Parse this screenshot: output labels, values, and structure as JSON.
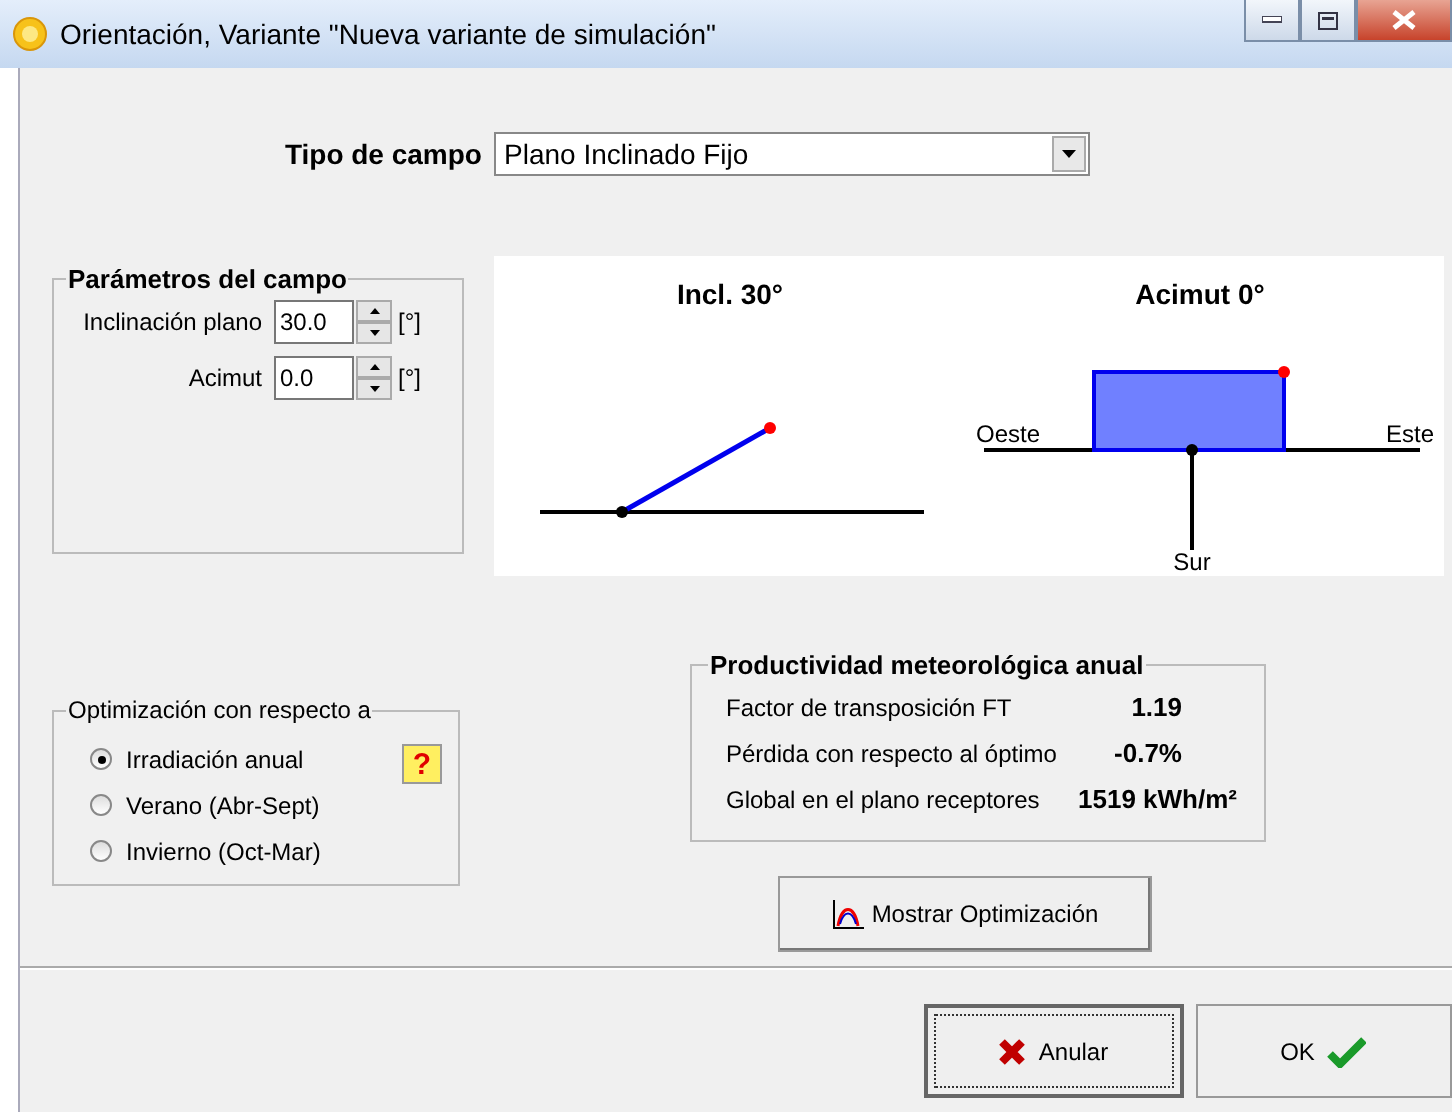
{
  "window": {
    "title": "Orientación, Variante \"Nueva variante de simulación\""
  },
  "field_type": {
    "label": "Tipo de campo",
    "value": "Plano Inclinado Fijo"
  },
  "field_parameters": {
    "title": "Parámetros del campo",
    "fields": [
      {
        "label": "Inclinación plano",
        "value": "30.0",
        "unit": "[°]"
      },
      {
        "label": "Acimut",
        "value": "0.0",
        "unit": "[°]"
      }
    ]
  },
  "diagram": {
    "tilt_title": "Incl. 30°",
    "azimuth_title": "Acimut 0°",
    "west": "Oeste",
    "east": "Este",
    "south": "Sur"
  },
  "optimization": {
    "title": "Optimización con respecto a",
    "help": "?",
    "options": [
      {
        "label": "Irradiación anual",
        "selected": true
      },
      {
        "label": "Verano (Abr-Sept)",
        "selected": false
      },
      {
        "label": "Invierno (Oct-Mar)",
        "selected": false
      }
    ]
  },
  "yield": {
    "title": "Productividad meteorológica anual",
    "rows": [
      {
        "label": "Factor de transposición FT",
        "value": "1.19"
      },
      {
        "label": "Pérdida con respecto al óptimo",
        "value": "-0.7%"
      },
      {
        "label": "Global en el plano receptores",
        "value": "1519 kWh/m²"
      }
    ]
  },
  "buttons": {
    "show_optimization": "Mostrar Optimización",
    "cancel": "Anular",
    "ok": "OK"
  }
}
